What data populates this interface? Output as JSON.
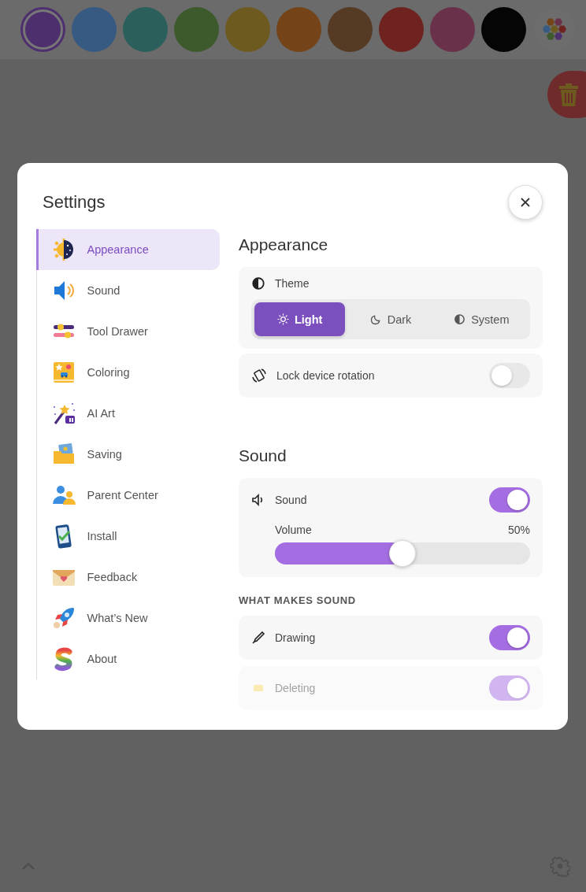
{
  "toolbar": {
    "swatches": [
      {
        "color": "#4e2f6e",
        "selected": true
      },
      {
        "color": "#365a82",
        "selected": false
      },
      {
        "color": "#2a5f5c",
        "selected": false
      },
      {
        "color": "#3c5a2c",
        "selected": false
      },
      {
        "color": "#6d5a1e",
        "selected": false
      },
      {
        "color": "#744418",
        "selected": false
      },
      {
        "color": "#553a24",
        "selected": false
      },
      {
        "color": "#6e2320",
        "selected": false
      },
      {
        "color": "#6a324a",
        "selected": false
      },
      {
        "color": "#050505",
        "selected": false
      }
    ]
  },
  "settings": {
    "title": "Settings",
    "nav": [
      {
        "label": "Appearance",
        "selected": true
      },
      {
        "label": "Sound",
        "selected": false
      },
      {
        "label": "Tool Drawer",
        "selected": false
      },
      {
        "label": "Coloring",
        "selected": false
      },
      {
        "label": "AI Art",
        "selected": false
      },
      {
        "label": "Saving",
        "selected": false
      },
      {
        "label": "Parent Center",
        "selected": false
      },
      {
        "label": "Install",
        "selected": false
      },
      {
        "label": "Feedback",
        "selected": false
      },
      {
        "label": "What’s New",
        "selected": false
      },
      {
        "label": "About",
        "selected": false
      }
    ],
    "appearance": {
      "heading": "Appearance",
      "theme": {
        "label": "Theme",
        "options": [
          {
            "label": "Light",
            "selected": true
          },
          {
            "label": "Dark",
            "selected": false
          },
          {
            "label": "System",
            "selected": false
          }
        ]
      },
      "lock_rotation": {
        "label": "Lock device rotation",
        "on": false
      }
    },
    "sound": {
      "heading": "Sound",
      "sound_toggle": {
        "label": "Sound",
        "on": true
      },
      "volume": {
        "label": "Volume",
        "reading": "50%",
        "level": 0.5
      },
      "subheading": "WHAT MAKES SOUND",
      "sources": [
        {
          "label": "Drawing",
          "on": true
        },
        {
          "label": "Deleting",
          "on": true
        }
      ]
    }
  }
}
